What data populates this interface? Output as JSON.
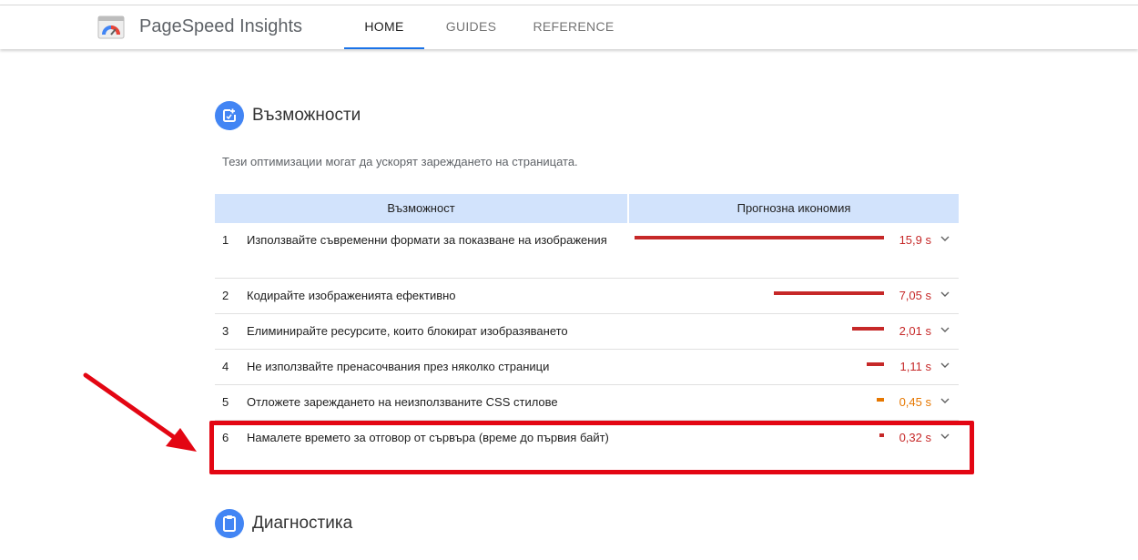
{
  "header": {
    "app_title": "PageSpeed Insights",
    "tabs": [
      {
        "label": "HOME",
        "active": true
      },
      {
        "label": "GUIDES",
        "active": false
      },
      {
        "label": "REFERENCE",
        "active": false
      }
    ]
  },
  "opportunities": {
    "title": "Възможности",
    "icon": "opportunity-icon",
    "description": "Тези оптимизации могат да ускорят зареждането на страницата.",
    "columns": [
      "Възможност",
      "Прогнозна икономия"
    ],
    "rows": [
      {
        "num": "1",
        "label": "Използвайте съвременни формати за показване на изображения",
        "value": "15,9 s",
        "fraction": 1.0,
        "color": "#c62828"
      },
      {
        "num": "2",
        "label": "Кодирайте изображенията ефективно",
        "value": "7,05 s",
        "fraction": 0.443,
        "color": "#c62828"
      },
      {
        "num": "3",
        "label": "Елиминирайте ресурсите, които блокират изобразяването",
        "value": "2,01 s",
        "fraction": 0.126,
        "color": "#c62828"
      },
      {
        "num": "4",
        "label": "Не използвайте пренасочвания през няколко страници",
        "value": "1,11 s",
        "fraction": 0.07,
        "color": "#c62828"
      },
      {
        "num": "5",
        "label": "Отложете зареждането на неизползваните CSS стилове",
        "value": "0,45 s",
        "fraction": 0.028,
        "color": "#e67700"
      },
      {
        "num": "6",
        "label": "Намалете времето за отговор от сървъра (време до първия байт)",
        "value": "0,32 s",
        "fraction": 0.02,
        "color": "#c62828"
      }
    ]
  },
  "diagnostics": {
    "title": "Диагностика",
    "icon": "clipboard-icon"
  },
  "colors": {
    "accent": "#1a73e8",
    "icon_bg": "#4285f4",
    "table_header": "#d2e3fc",
    "slow": "#c62828",
    "average": "#e67700",
    "highlight": "#e30613"
  }
}
